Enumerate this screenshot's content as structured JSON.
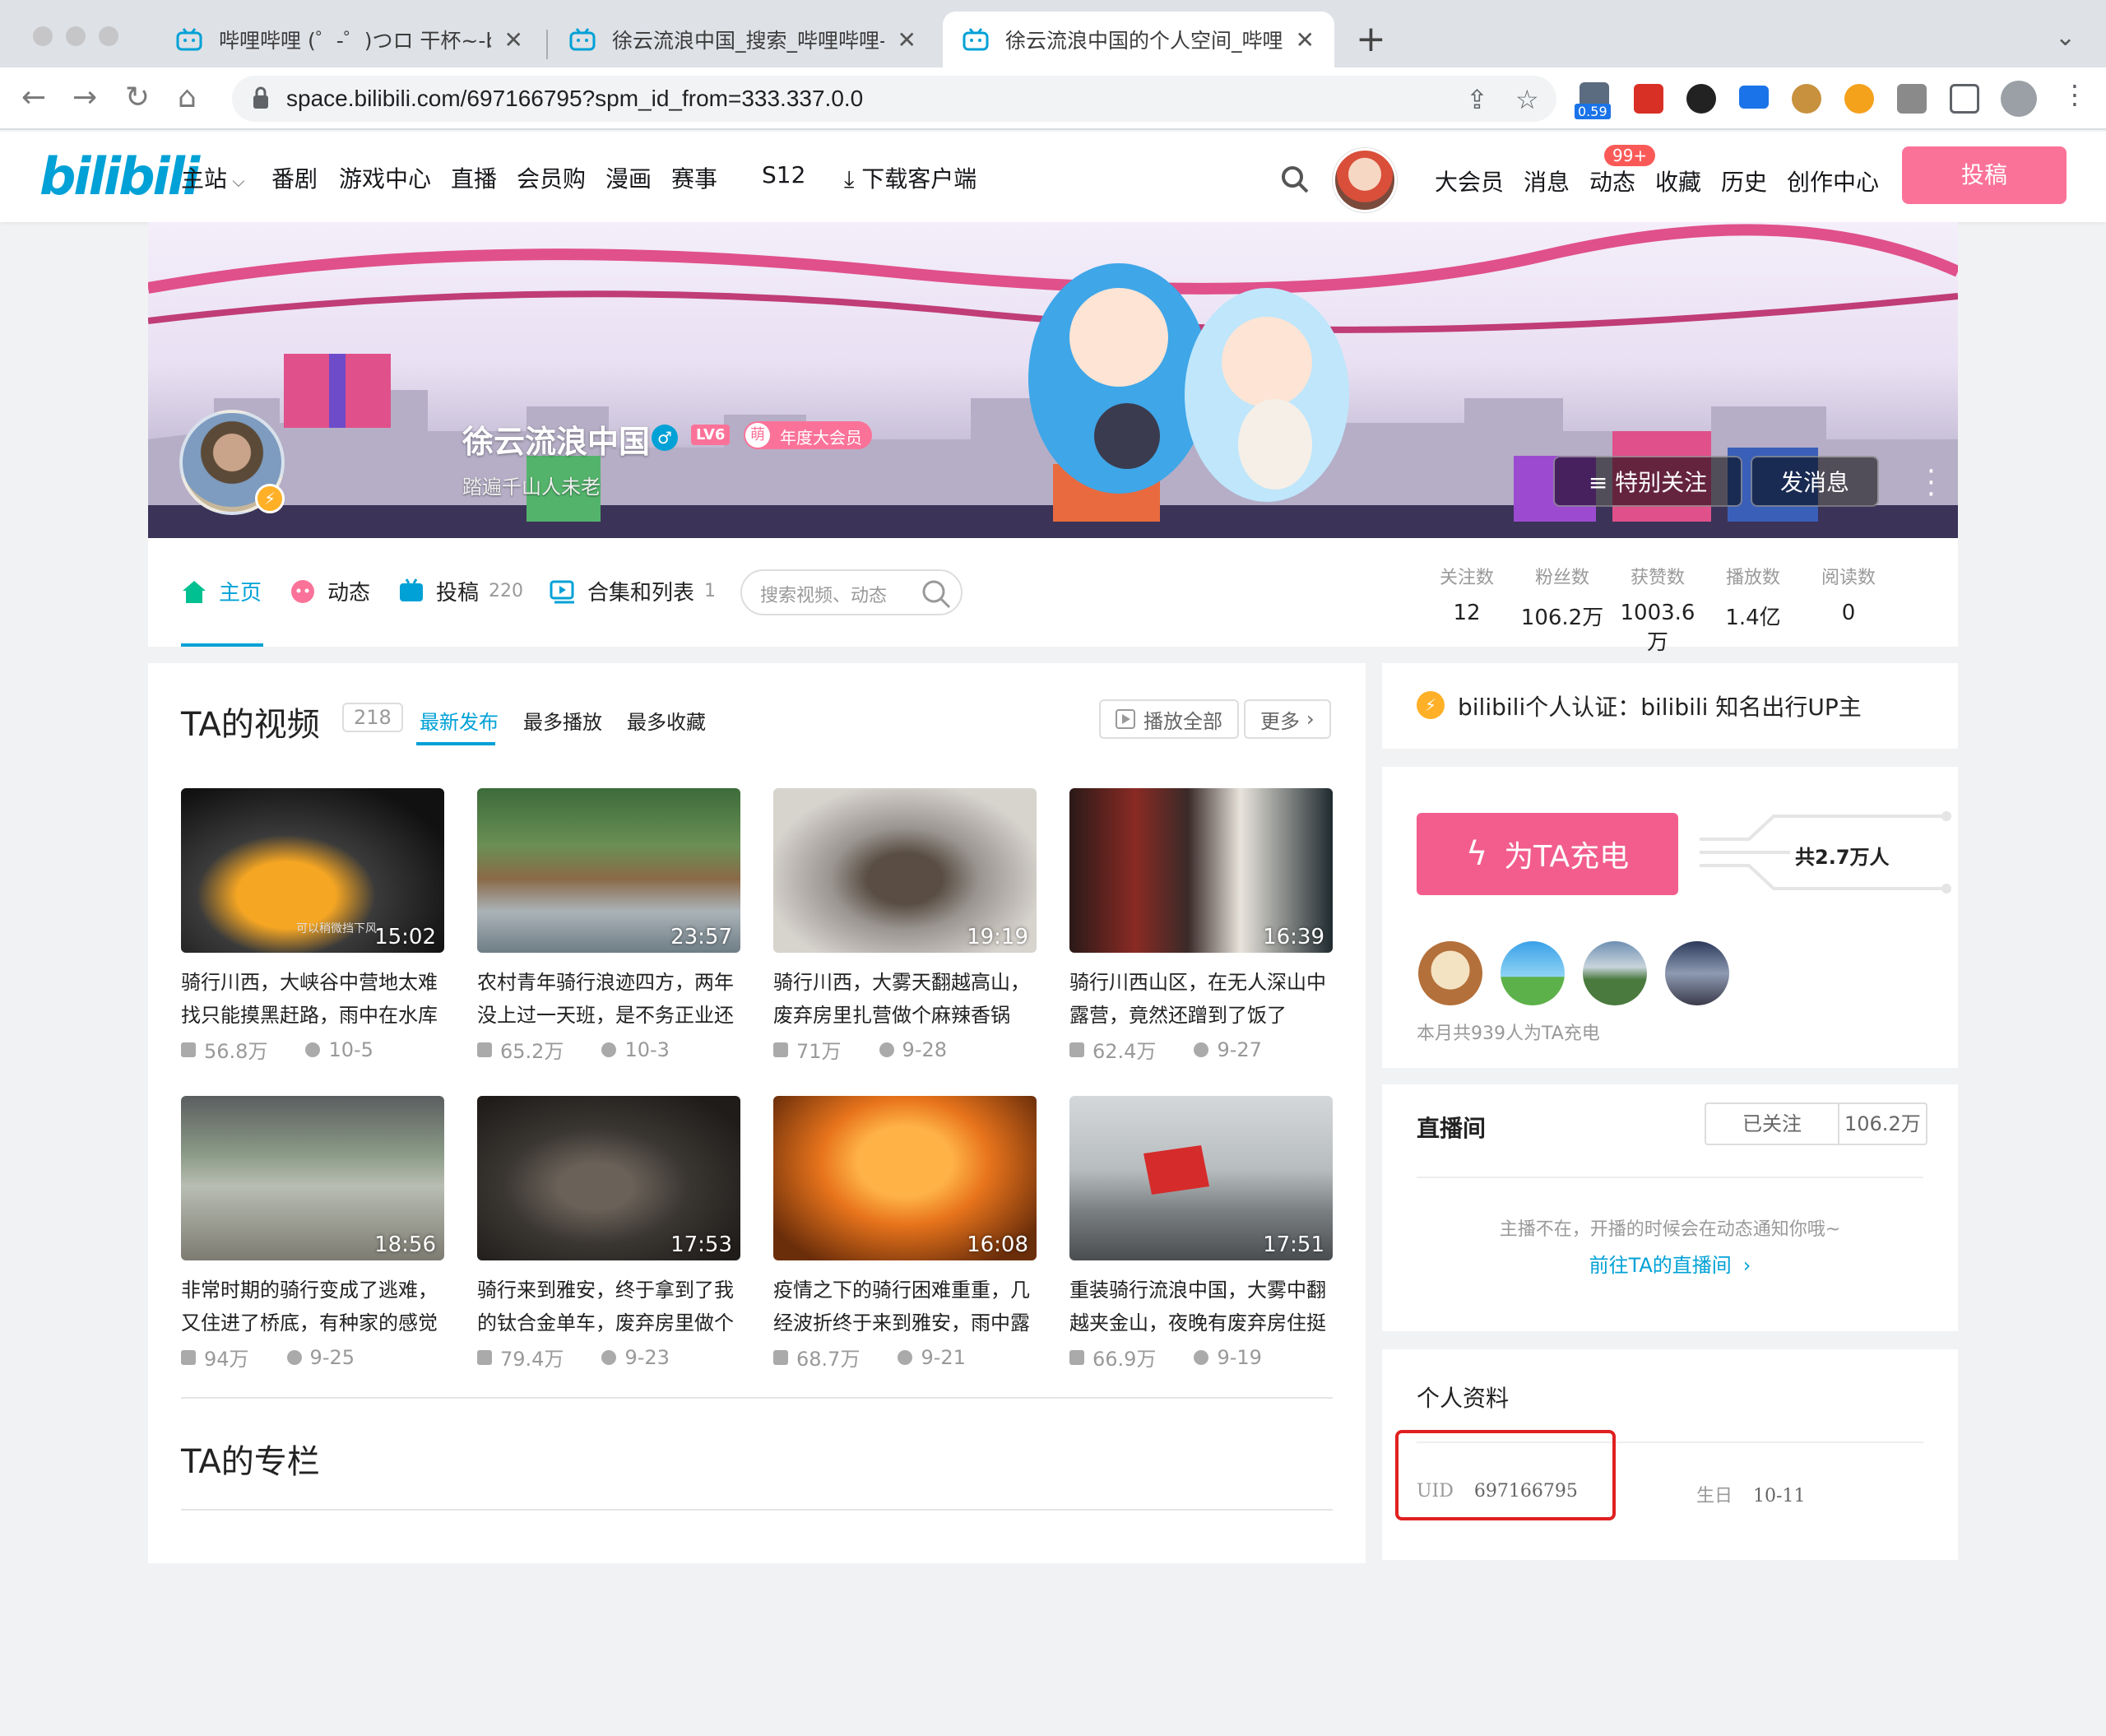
{
  "browser": {
    "tabs": [
      {
        "title": "哔哩哔哩 (゜-゜)つロ 干杯~-bilibili"
      },
      {
        "title": "徐云流浪中国_搜索_哔哩哔哩-bilibili"
      },
      {
        "title": "徐云流浪中国的个人空间_哔哩哔哩"
      }
    ],
    "url": "space.bilibili.com/697166795?spm_id_from=333.337.0.0",
    "ext_badge": "0.59"
  },
  "header": {
    "logo": "bilibili",
    "nav": [
      "主站",
      "番剧",
      "游戏中心",
      "直播",
      "会员购",
      "漫画",
      "赛事",
      "S12",
      "下载客户端"
    ],
    "right": [
      "大会员",
      "消息",
      "动态",
      "收藏",
      "历史",
      "创作中心"
    ],
    "badge": "99+",
    "upload": "投稿"
  },
  "profile": {
    "name": "徐云流浪中国",
    "level": "LV6",
    "vip": "年度大会员",
    "sign": "踏遍千山人未老",
    "follow_special": "≡ 特别关注",
    "send_msg": "发消息"
  },
  "tabs": {
    "home": "主页",
    "dynamic": "动态",
    "posts": "投稿",
    "posts_count": "220",
    "collections": "合集和列表",
    "collections_count": "1",
    "search_placeholder": "搜索视频、动态"
  },
  "stats": [
    {
      "label": "关注数",
      "value": "12"
    },
    {
      "label": "粉丝数",
      "value": "106.2万"
    },
    {
      "label": "获赞数",
      "value": "1003.6万"
    },
    {
      "label": "播放数",
      "value": "1.4亿"
    },
    {
      "label": "阅读数",
      "value": "0"
    }
  ],
  "videos_section": {
    "title": "TA的视频",
    "count": "218",
    "filters": [
      "最新发布",
      "最多播放",
      "最多收藏"
    ],
    "play_all": "播放全部",
    "more": "更多",
    "list": [
      {
        "title": "骑行川西，大峡谷中营地太难找只能摸黑赶路，雨中在水库",
        "duration": "15:02",
        "views": "56.8万",
        "date": "10-5",
        "thumb_text": "可以稍微挡下风"
      },
      {
        "title": "农村青年骑行浪迹四方，两年没上过一天班，是不务正业还",
        "duration": "23:57",
        "views": "65.2万",
        "date": "10-3"
      },
      {
        "title": "骑行川西，大雾天翻越高山，废弃房里扎营做个麻辣香锅",
        "duration": "19:19",
        "views": "71万",
        "date": "9-28"
      },
      {
        "title": "骑行川西山区，在无人深山中露营，竟然还蹭到了饭了",
        "duration": "16:39",
        "views": "62.4万",
        "date": "9-27"
      },
      {
        "title": "非常时期的骑行变成了逃难，又住进了桥底，有种家的感觉",
        "duration": "18:56",
        "views": "94万",
        "date": "9-25"
      },
      {
        "title": "骑行来到雅安，终于拿到了我的钛合金单车，废弃房里做个",
        "duration": "17:53",
        "views": "79.4万",
        "date": "9-23"
      },
      {
        "title": "疫情之下的骑行困难重重，几经波折终于来到雅安，雨中露",
        "duration": "16:08",
        "views": "68.7万",
        "date": "9-21"
      },
      {
        "title": "重装骑行流浪中国，大雾中翻越夹金山，夜晚有废弃房住挺",
        "duration": "17:51",
        "views": "66.9万",
        "date": "9-19"
      }
    ]
  },
  "column_section": {
    "title": "TA的专栏"
  },
  "auth": {
    "text": "bilibili个人认证：bilibili 知名出行UP主"
  },
  "charge": {
    "button": "为TA充电",
    "total_prefix": "共",
    "total": "2.7万",
    "total_suffix": "人",
    "month_text": "本月共939人为TA充电"
  },
  "live": {
    "title": "直播间",
    "followed": "已关注",
    "fans": "106.2万",
    "offline": "主播不在，开播的时候会在动态通知你哦~",
    "link": "前往TA的直播间"
  },
  "info": {
    "title": "个人资料",
    "uid_label": "UID",
    "uid": "697166795",
    "birthday_label": "生日",
    "birthday": "10-11"
  },
  "colors": {
    "bili_blue": "#00a1d6",
    "bili_pink": "#fb7299",
    "charge_pink": "#f25d8e",
    "highlight_red": "#e02020"
  }
}
